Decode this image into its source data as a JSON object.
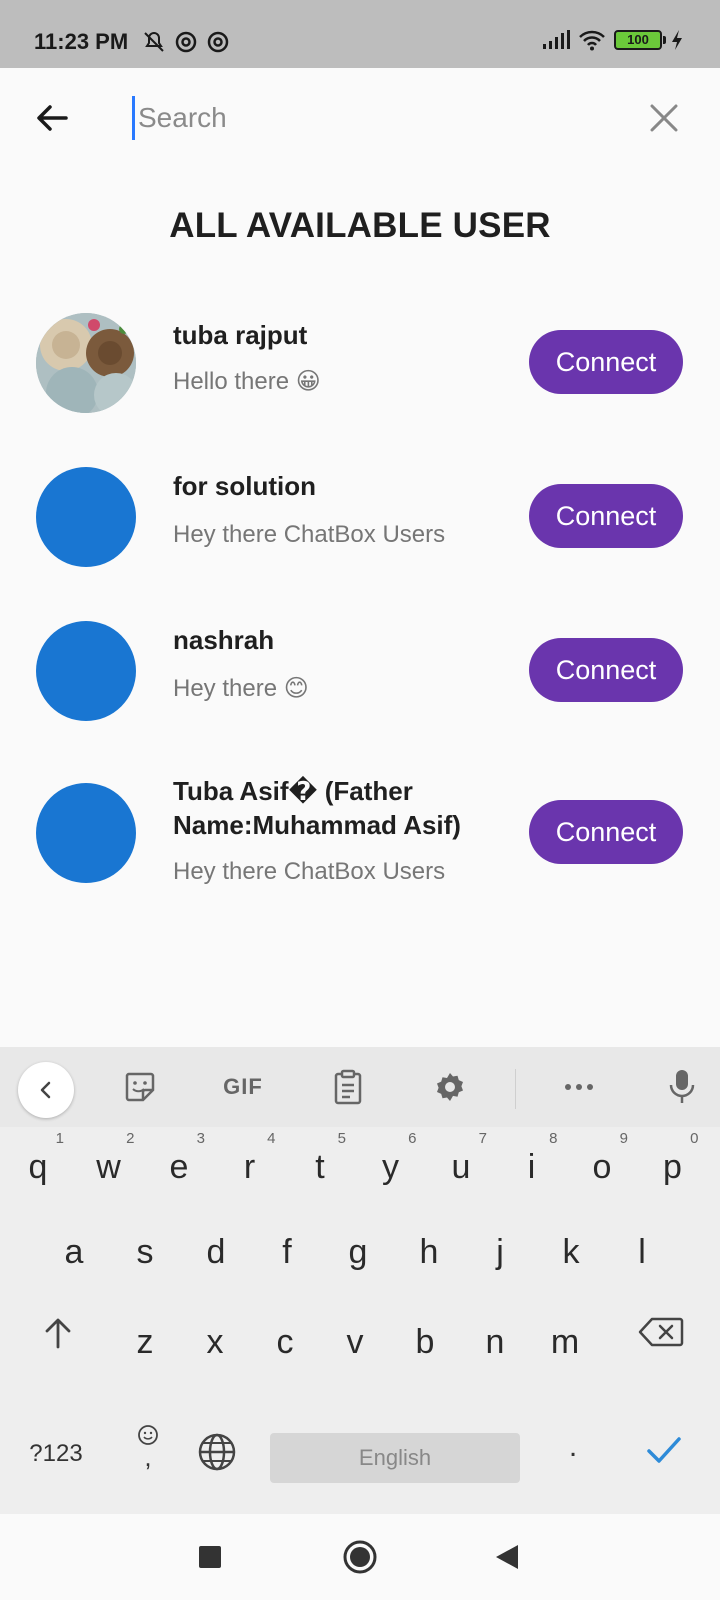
{
  "status_bar": {
    "time": "11:23 PM",
    "battery": "100",
    "icons_left": [
      "mute-icon",
      "at-icon",
      "at-icon"
    ],
    "icons_right": [
      "signal-icon",
      "wifi-icon",
      "battery-icon",
      "charging-icon"
    ]
  },
  "search": {
    "placeholder": "Search",
    "value": ""
  },
  "page": {
    "title": "ALL AVAILABLE USER"
  },
  "users": [
    {
      "name": "tuba rajput",
      "status": "Hello there 😀",
      "avatar": "photo",
      "button": "Connect"
    },
    {
      "name": "for solution",
      "status": "Hey there ChatBox Users",
      "avatar": "blue-circle",
      "button": "Connect"
    },
    {
      "name": "nashrah",
      "status": "Hey there 😊",
      "avatar": "blue-circle",
      "button": "Connect"
    },
    {
      "name": "Tuba Asif� (Father Name:Muhammad Asif)",
      "status": "Hey there ChatBox Users",
      "avatar": "blue-circle",
      "button": "Connect"
    }
  ],
  "keyboard": {
    "toolbar_gif": "GIF",
    "row1": [
      {
        "ch": "q",
        "num": "1"
      },
      {
        "ch": "w",
        "num": "2"
      },
      {
        "ch": "e",
        "num": "3"
      },
      {
        "ch": "r",
        "num": "4"
      },
      {
        "ch": "t",
        "num": "5"
      },
      {
        "ch": "y",
        "num": "6"
      },
      {
        "ch": "u",
        "num": "7"
      },
      {
        "ch": "i",
        "num": "8"
      },
      {
        "ch": "o",
        "num": "9"
      },
      {
        "ch": "p",
        "num": "0"
      }
    ],
    "row2": [
      "a",
      "s",
      "d",
      "f",
      "g",
      "h",
      "j",
      "k",
      "l"
    ],
    "row3": [
      "z",
      "x",
      "c",
      "v",
      "b",
      "n",
      "m"
    ],
    "symbols_key": "?123",
    "comma_key": ",",
    "space_label": "English",
    "period_key": "."
  },
  "colors": {
    "accent": "#6a35ad",
    "avatar_blue": "#1976d2",
    "status_bar": "#bdbdbd",
    "enter_check": "#2e8bd8"
  }
}
